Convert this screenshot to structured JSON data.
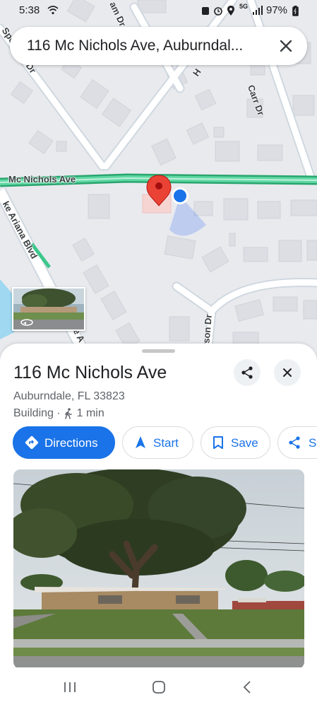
{
  "status_bar": {
    "time": "5:38",
    "battery": "97%",
    "network": "5G"
  },
  "search": {
    "query": "116 Mc Nichols Ave, Auburndal..."
  },
  "map": {
    "road_labels": {
      "mc_nichols": "Mc Nichols Ave",
      "ariana": "ke Ariana Blvd",
      "carr": "Carr Dr",
      "sp": "Spe",
      "dr_left": "Dr",
      "am_dr": "am Dr",
      "h": "H",
      "son_dr": "rson Dr",
      "ave_bottom": "e A"
    },
    "colors": {
      "land": "#e9eaee",
      "road": "#ffffff",
      "road_edge": "#cfd8e0",
      "main_road": "#3cc78b",
      "water": "#9fd8f0",
      "pin": "#ea4335",
      "location_dot": "#1a73e8"
    }
  },
  "place": {
    "title": "116 Mc Nichols Ave",
    "address": "Auburndale, FL 33823",
    "type": "Building",
    "walk_time": "1 min"
  },
  "actions": {
    "directions": "Directions",
    "start": "Start",
    "save": "Save",
    "share": "Sh"
  },
  "icons": {
    "share": "share-icon",
    "close": "close-icon",
    "directions": "directions-icon",
    "navigation": "navigation-arrow-icon",
    "bookmark": "bookmark-icon",
    "walk": "walk-icon"
  },
  "accent_color": "#1a73e8"
}
